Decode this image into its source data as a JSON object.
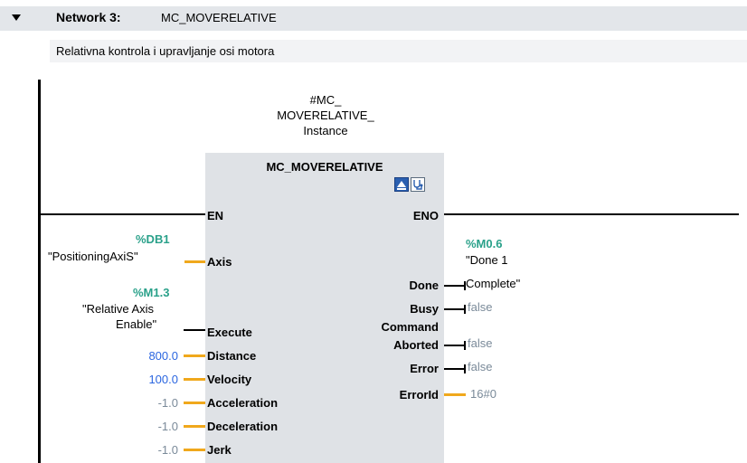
{
  "network": {
    "label": "Network 3:",
    "name": "MC_MOVERELATIVE",
    "comment": "Relativna kontrola i upravljanje osi motora"
  },
  "block": {
    "instance_lines": [
      "#MC_",
      "MOVERELATIVE_",
      "Instance"
    ],
    "title": "MC_MOVERELATIVE",
    "icons": [
      "download-icon",
      "stethoscope-icon"
    ],
    "pins": {
      "en": "EN",
      "eno": "ENO",
      "axis": "Axis",
      "execute": "Execute",
      "distance": "Distance",
      "velocity": "Velocity",
      "acceleration": "Acceleration",
      "deceleration": "Deceleration",
      "jerk": "Jerk",
      "done": "Done",
      "busy": "Busy",
      "command_aborted_line1": "Command",
      "command_aborted_line2": "Aborted",
      "error": "Error",
      "errorid": "ErrorId"
    }
  },
  "inputs": {
    "axis_addr": "%DB1",
    "axis_tag": "\"PositioningAxiS\"",
    "execute_addr": "%M1.3",
    "execute_tag_line1": "\"Relative Axis",
    "execute_tag_line2": "Enable\"",
    "distance": "800.0",
    "velocity": "100.0",
    "acceleration": "-1.0",
    "deceleration": "-1.0",
    "jerk": "-1.0"
  },
  "outputs": {
    "done_addr": "%M0.6",
    "done_tag_line1": "\"Done 1",
    "done_tag_line2": "Complete\"",
    "busy": "false",
    "aborted": "false",
    "error": "false",
    "errorid": "16#0"
  },
  "colors": {
    "header_bg": "#e3e6ea",
    "block_bg": "#dfe2e6",
    "constant_blue": "#2b66e0",
    "address_green": "#2aa18a",
    "wire_orange": "#f0a81c",
    "status_gray": "#7a8a99"
  }
}
